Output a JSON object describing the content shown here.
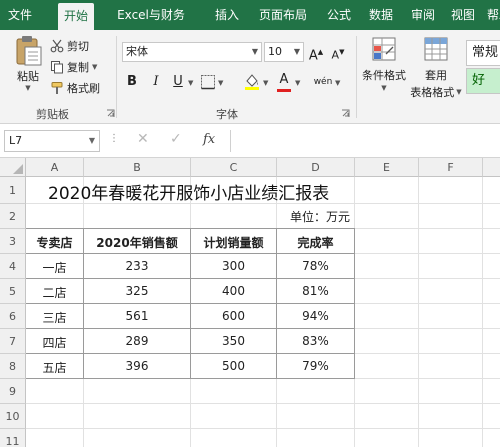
{
  "menu": {
    "tabs": [
      "文件",
      "开始",
      "Excel与财务",
      "插入",
      "页面布局",
      "公式",
      "数据",
      "审阅",
      "视图",
      "帮助"
    ],
    "active": "开始"
  },
  "ribbon": {
    "clipboard": {
      "paste": "粘贴",
      "cut": "剪切",
      "copy": "复制",
      "format_painter": "格式刷",
      "group_label": "剪贴板"
    },
    "font": {
      "font_name": "宋体",
      "font_size": "10",
      "grow": "A",
      "shrink": "A",
      "bold": "B",
      "italic": "I",
      "underline": "U",
      "font_color_letter": "A",
      "wen": "wén",
      "group_label": "字体"
    },
    "styles": {
      "conditional_format": "条件格式",
      "table_format_line1": "套用",
      "table_format_line2": "表格格式",
      "normal_style": "常规",
      "good_style": "好"
    }
  },
  "formula_bar": {
    "name_box": "L7",
    "fx": "fx",
    "formula": ""
  },
  "sheet": {
    "columns": [
      "A",
      "B",
      "C",
      "D",
      "E",
      "F"
    ],
    "rows": [
      "1",
      "2",
      "3",
      "4",
      "5",
      "6",
      "7",
      "8",
      "9",
      "10",
      "11"
    ],
    "title": "2020年春暖花开服饰小店业绩汇报表",
    "unit": "单位：万元",
    "headers": [
      "专卖店",
      "2020年销售额",
      "计划销量额",
      "完成率"
    ],
    "data": [
      [
        "一店",
        "233",
        "300",
        "78%"
      ],
      [
        "二店",
        "325",
        "400",
        "81%"
      ],
      [
        "三店",
        "561",
        "600",
        "94%"
      ],
      [
        "四店",
        "289",
        "350",
        "83%"
      ],
      [
        "五店",
        "396",
        "500",
        "79%"
      ]
    ]
  }
}
